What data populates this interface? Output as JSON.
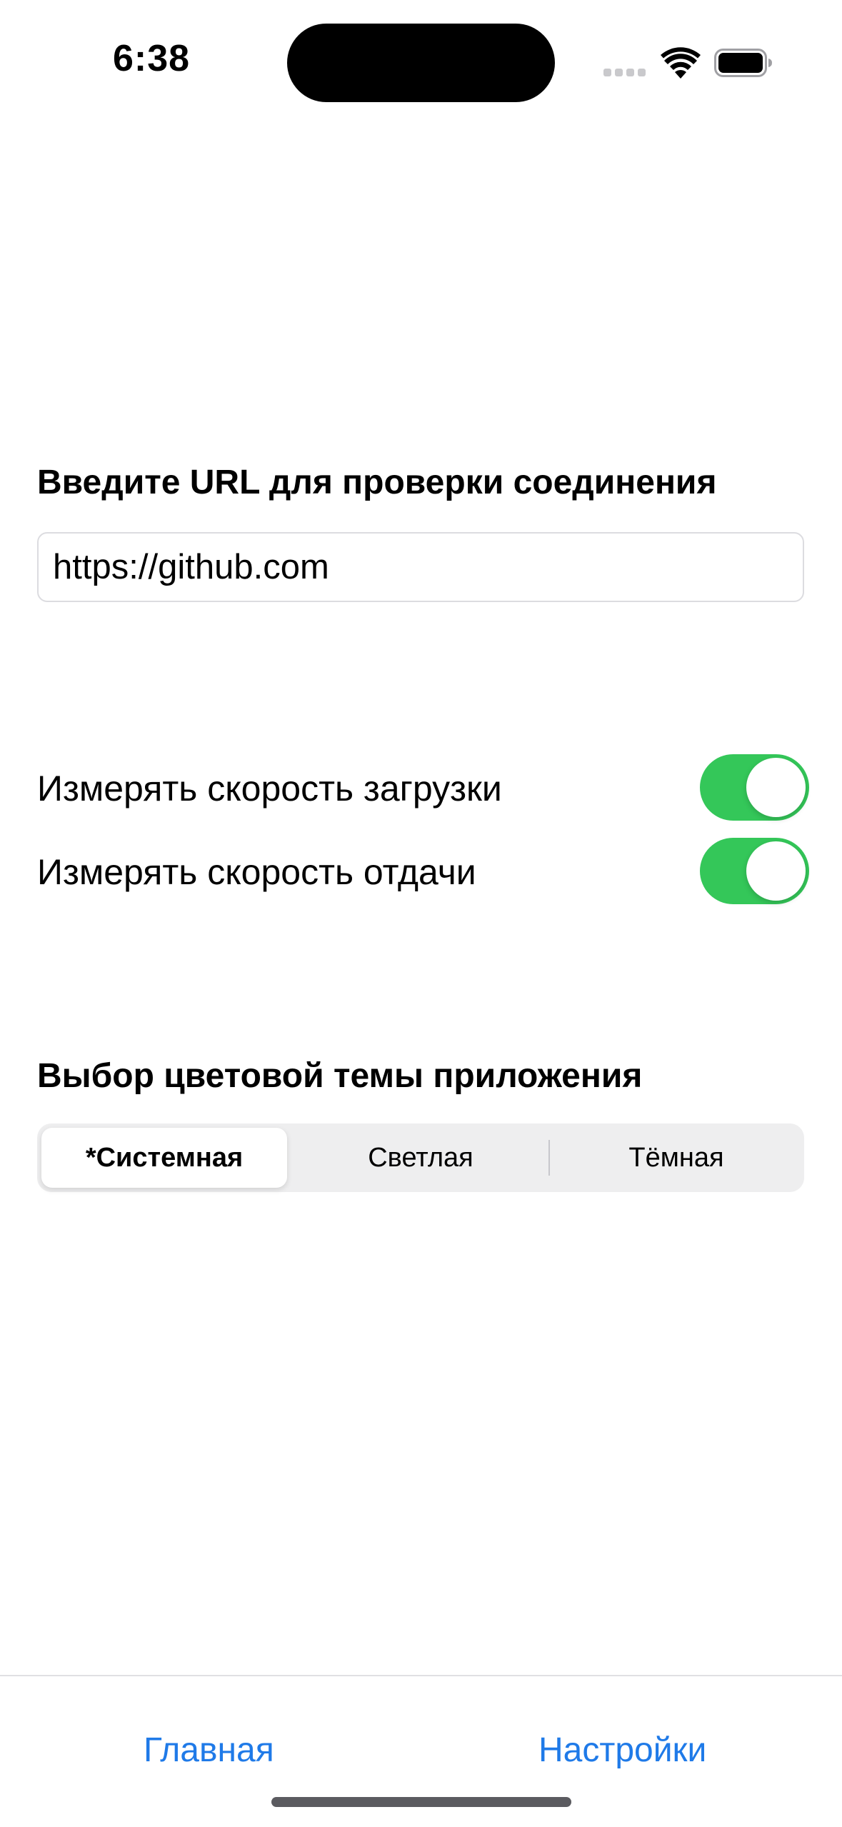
{
  "status_bar": {
    "time": "6:38"
  },
  "url_section": {
    "heading": "Введите URL для проверки соединения",
    "value": "https://github.com",
    "placeholder": ""
  },
  "toggles": [
    {
      "label": "Измерять скорость загрузки",
      "on": true
    },
    {
      "label": "Измерять скорость отдачи",
      "on": true
    }
  ],
  "theme_section": {
    "heading": "Выбор цветовой темы приложения",
    "options": [
      "*Системная",
      "Светлая",
      "Тёмная"
    ],
    "selected": "*Системная"
  },
  "tab_bar": {
    "items": [
      "Главная",
      "Настройки"
    ]
  },
  "colors": {
    "accent": "#1f7ae8",
    "toggle_on": "#34c759"
  },
  "icons": [
    "cellular-signal-icon",
    "wifi-icon",
    "battery-icon"
  ]
}
